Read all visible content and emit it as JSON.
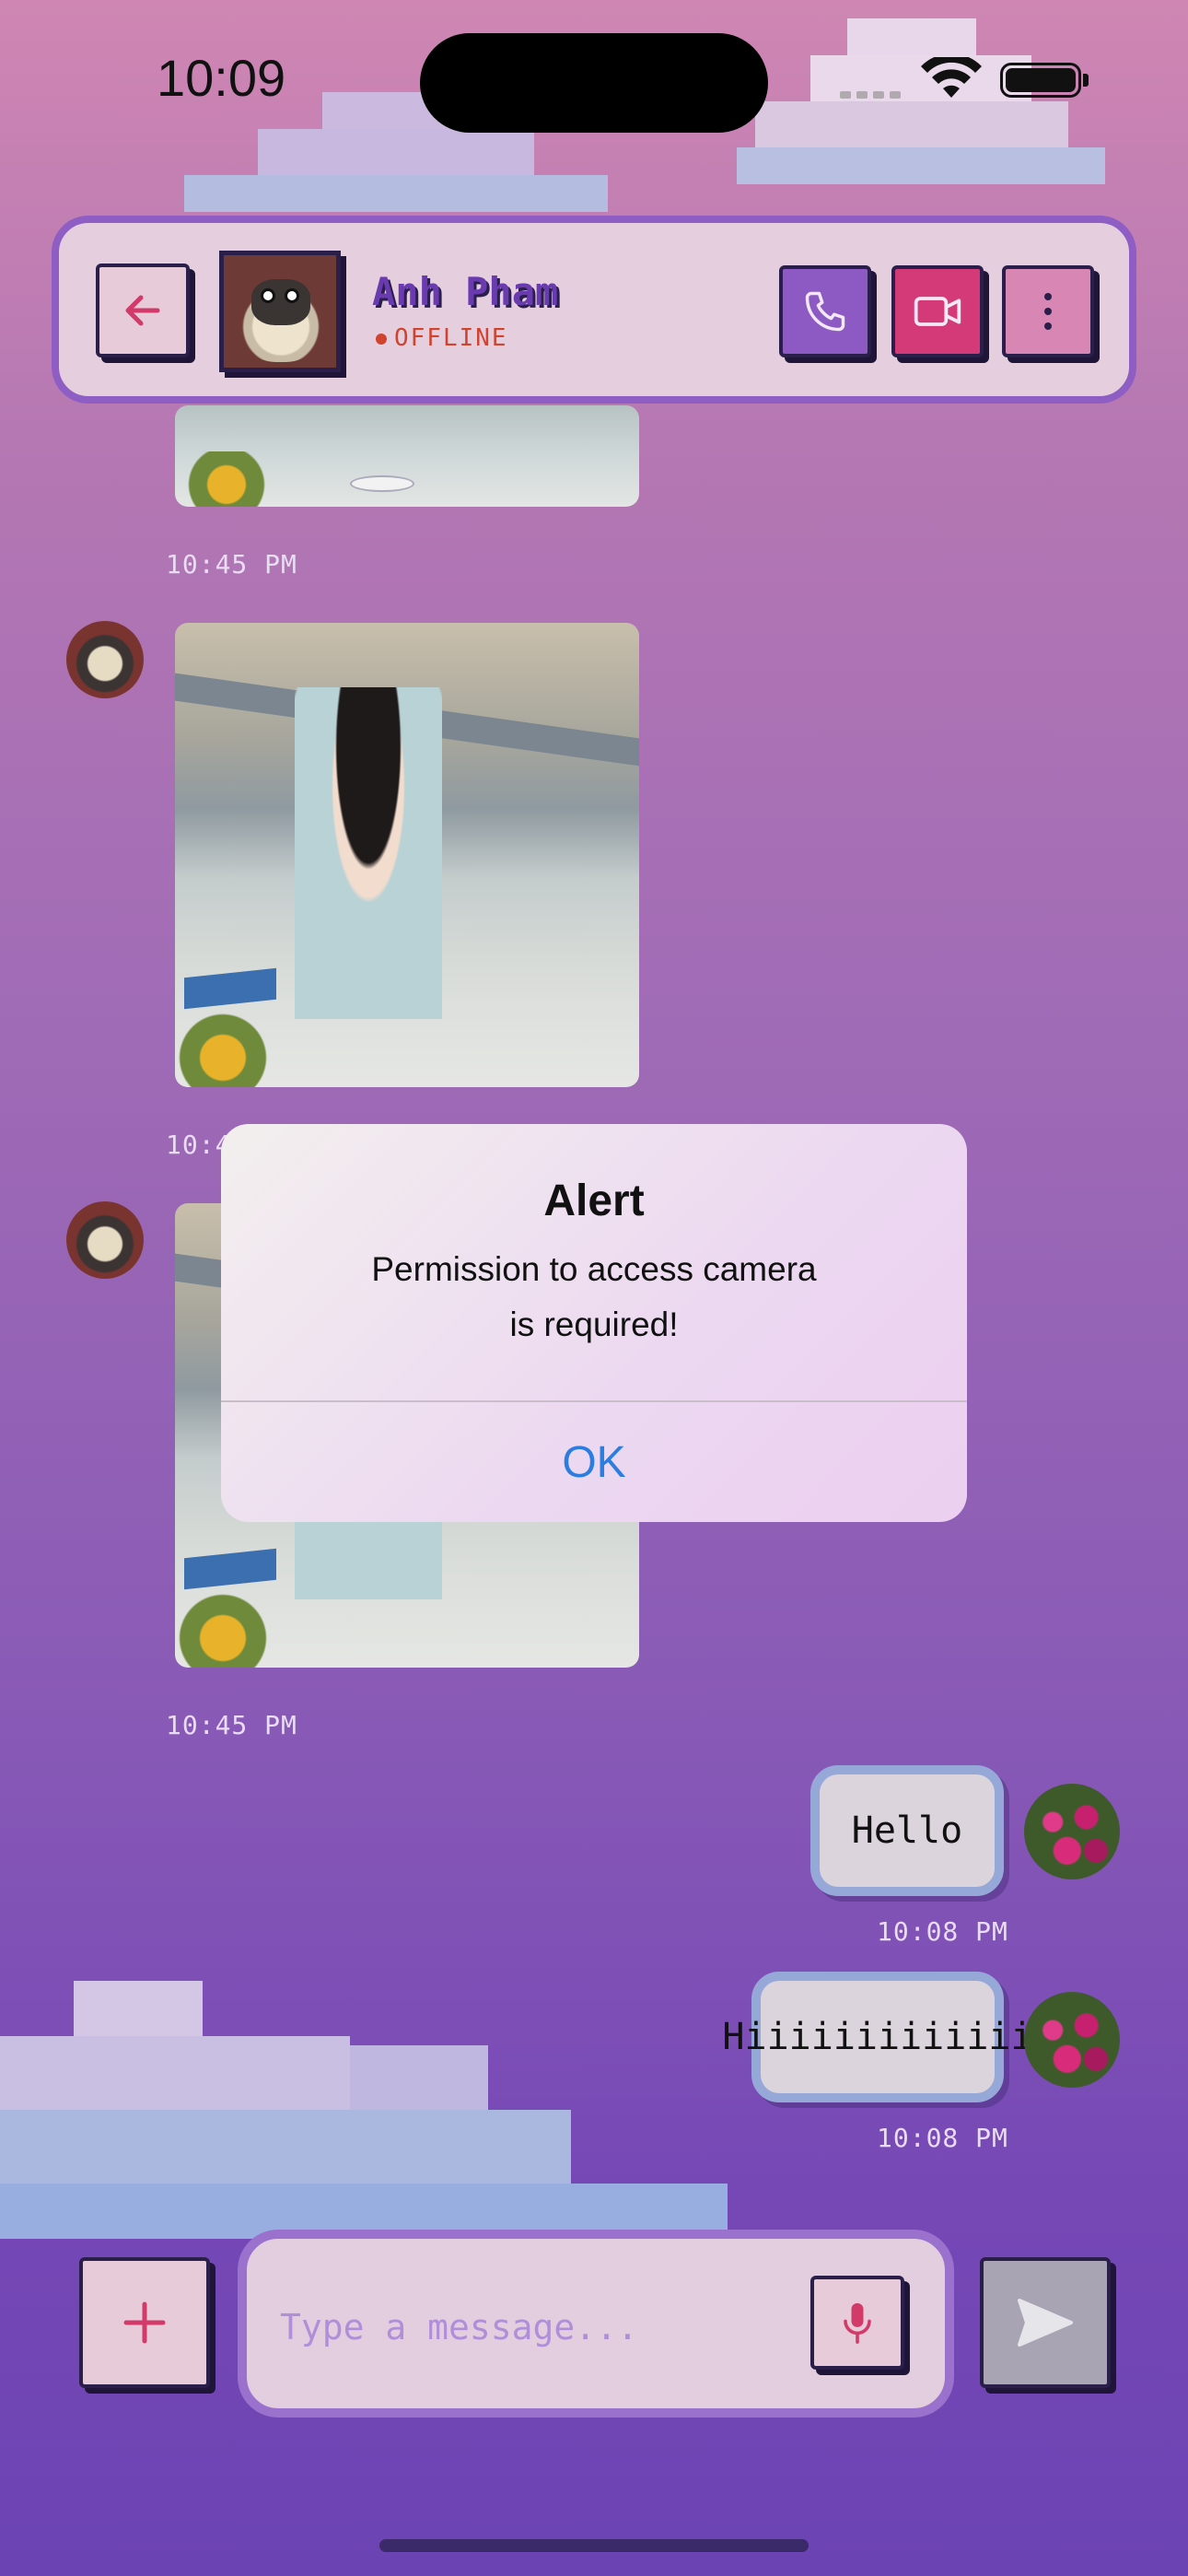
{
  "status_bar": {
    "time": "10:09"
  },
  "header": {
    "contact_name": "Anh Pham",
    "contact_status": "OFFLINE"
  },
  "messages": {
    "timestamps": [
      "10:45 PM",
      "10:4",
      "10:45 PM"
    ],
    "outgoing": [
      {
        "text": "Hello",
        "time": "10:08 PM"
      },
      {
        "text": "Hiiiiiiiiiiiii",
        "time": "10:08 PM"
      }
    ]
  },
  "alert": {
    "title": "Alert",
    "message_line1": "Permission to access camera",
    "message_line2": "is required!",
    "ok_label": "OK"
  },
  "composer": {
    "placeholder": "Type a message..."
  },
  "colors": {
    "accent_purple": "#8d5ac4",
    "video_pink": "#d53a78",
    "offline_red": "#d0432f",
    "alert_button_blue": "#2b7de0"
  },
  "icons": [
    "back-arrow-icon",
    "phone-icon",
    "video-camera-icon",
    "more-vertical-icon",
    "plus-icon",
    "microphone-icon",
    "send-icon"
  ]
}
